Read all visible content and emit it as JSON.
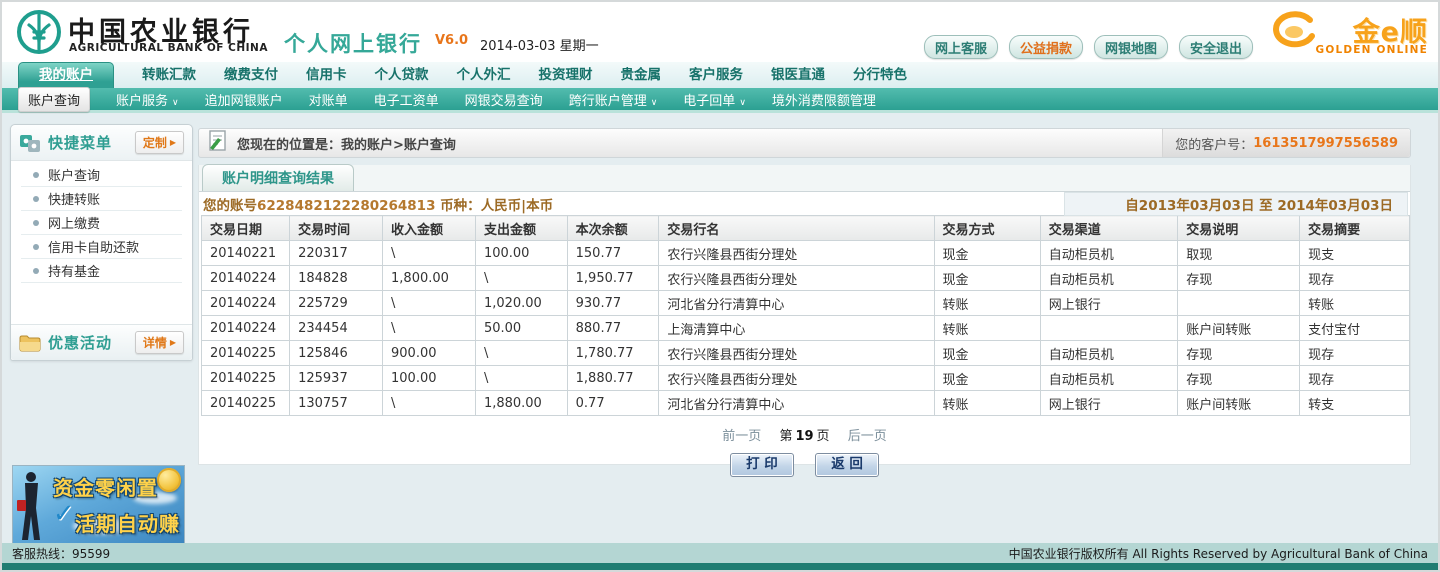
{
  "brand_colors": {
    "teal": "#2fa093",
    "orange": "#e8751a",
    "gold": "#f7a21b",
    "footer_teal": "#1f7d72"
  },
  "header": {
    "bank_name_cn": "中国农业银行",
    "bank_name_en": "AGRICULTURAL BANK OF CHINA",
    "product": "个人网上银行",
    "version": "V6.0",
    "date_text": "2014-03-03 星期一",
    "buttons": [
      {
        "label": "网上客服",
        "accent": false
      },
      {
        "label": "公益捐款",
        "accent": true
      },
      {
        "label": "网银地图",
        "accent": false
      },
      {
        "label": "安全退出",
        "accent": false
      }
    ],
    "golden_cn": "金e顺",
    "golden_en": "GOLDEN ONLINE"
  },
  "nav": {
    "active_index": 0,
    "tabs": [
      "我的账户",
      "转账汇款",
      "缴费支付",
      "信用卡",
      "个人贷款",
      "个人外汇",
      "投资理财",
      "贵金属",
      "客户服务",
      "银医直通",
      "分行特色"
    ]
  },
  "subnav": {
    "items": [
      {
        "label": "账户查询",
        "active": true,
        "dropdown": false
      },
      {
        "label": "账户服务",
        "active": false,
        "dropdown": true
      },
      {
        "label": "追加网银账户",
        "active": false,
        "dropdown": false
      },
      {
        "label": "对账单",
        "active": false,
        "dropdown": false
      },
      {
        "label": "电子工资单",
        "active": false,
        "dropdown": false
      },
      {
        "label": "网银交易查询",
        "active": false,
        "dropdown": false
      },
      {
        "label": "跨行账户管理",
        "active": false,
        "dropdown": true
      },
      {
        "label": "电子回单",
        "active": false,
        "dropdown": true
      },
      {
        "label": "境外消费限额管理",
        "active": false,
        "dropdown": false
      }
    ]
  },
  "sidebar": {
    "quick_title": "快捷菜单",
    "customize_label": "定制",
    "items": [
      "账户查询",
      "快捷转账",
      "网上缴费",
      "信用卡自助还款",
      "持有基金"
    ],
    "promo_title": "优惠活动",
    "details_label": "详情"
  },
  "main": {
    "breadcrumb": "您现在的位置是：我的账户>账户查询",
    "client_label": "您的客户号：",
    "client_number": "1613517997556589",
    "tab_label": "账户明细查询结果",
    "account_label": "您的账号",
    "account_number": "6228482122280264813",
    "currency_label": " 币种：",
    "currency_value": "人民币|本币",
    "date_range": "自2013年03月03日  至  2014年03月03日",
    "table": {
      "headers": [
        "交易日期",
        "交易时间",
        "收入金额",
        "支出金额",
        "本次余额",
        "交易行名",
        "交易方式",
        "交易渠道",
        "交易说明",
        "交易摘要"
      ],
      "rows": [
        [
          "20140221",
          "220317",
          "\\",
          "100.00",
          "150.77",
          "农行兴隆县西街分理处",
          "现金",
          "自动柜员机",
          "取现",
          "现支"
        ],
        [
          "20140224",
          "184828",
          "1,800.00",
          "\\",
          "1,950.77",
          "农行兴隆县西街分理处",
          "现金",
          "自动柜员机",
          "存现",
          "现存"
        ],
        [
          "20140224",
          "225729",
          "\\",
          "1,020.00",
          "930.77",
          "河北省分行清算中心",
          "转账",
          "网上银行",
          "",
          "转账"
        ],
        [
          "20140224",
          "234454",
          "\\",
          "50.00",
          "880.77",
          "上海清算中心",
          "转账",
          "",
          "账户间转账",
          "支付宝付"
        ],
        [
          "20140225",
          "125846",
          "900.00",
          "\\",
          "1,780.77",
          "农行兴隆县西街分理处",
          "现金",
          "自动柜员机",
          "存现",
          "现存"
        ],
        [
          "20140225",
          "125937",
          "100.00",
          "\\",
          "1,880.77",
          "农行兴隆县西街分理处",
          "现金",
          "自动柜员机",
          "存现",
          "现存"
        ],
        [
          "20140225",
          "130757",
          "\\",
          "1,880.00",
          "0.77",
          "河北省分行清算中心",
          "转账",
          "网上银行",
          "账户间转账",
          "转支"
        ]
      ]
    },
    "pagination": {
      "prev": "前一页",
      "page_prefix": "第",
      "page_number": "19",
      "page_suffix": "页",
      "next": "后一页"
    },
    "print_label": "打 印",
    "back_label": "返 回"
  },
  "ad": {
    "line1": "资金零闲置",
    "line2": "活期自动赚"
  },
  "footer": {
    "hotline_label": "客服热线：",
    "hotline_number": "95599",
    "copyright_cn": "中国农业银行版权所有",
    "copyright_en": "All Rights Reserved by Agricultural Bank of China"
  }
}
